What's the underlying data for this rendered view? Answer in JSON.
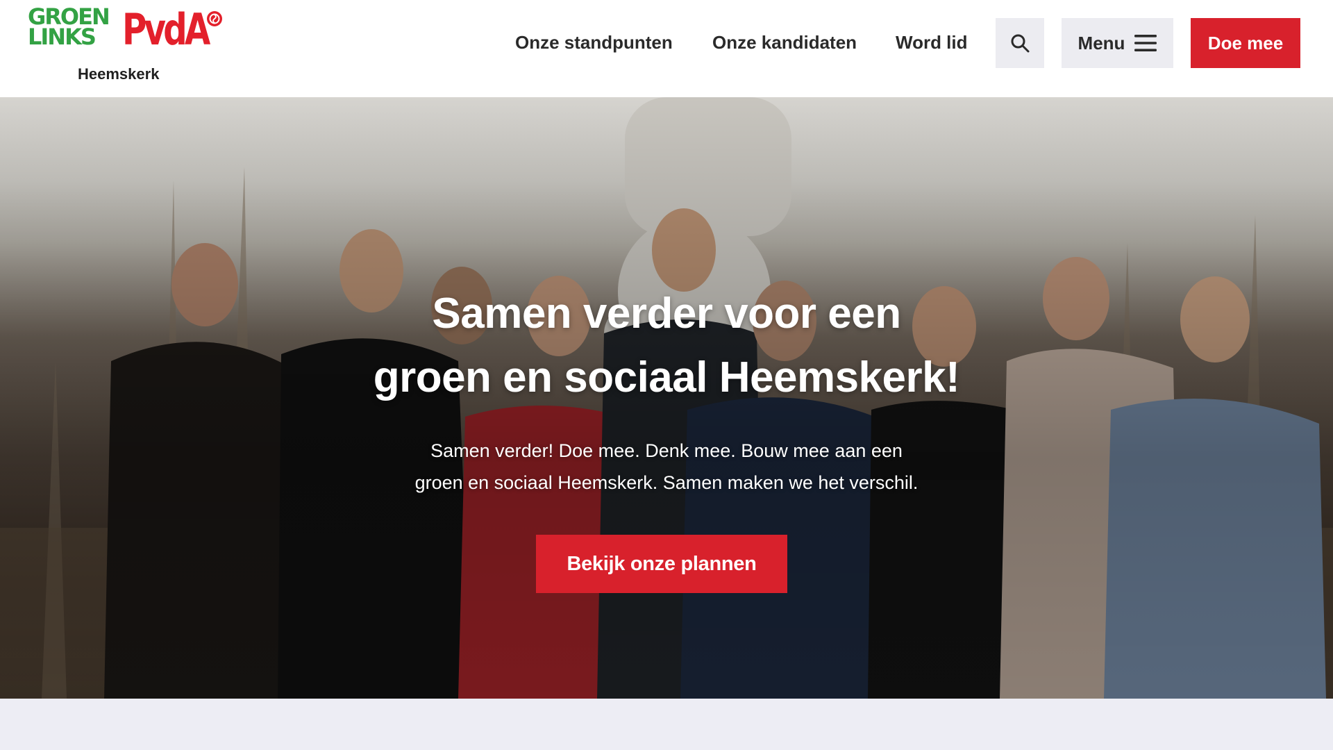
{
  "logo": {
    "line1": "GROEN",
    "line2": "LINKS",
    "brand": "PvdA",
    "location": "Heemskerk",
    "green": "#33a244",
    "red": "#e3202b",
    "rose_icon": "rose-icon"
  },
  "nav": {
    "items": [
      {
        "label": "Onze standpunten"
      },
      {
        "label": "Onze kandidaten"
      },
      {
        "label": "Word lid"
      }
    ],
    "search_icon": "search-icon",
    "menu_label": "Menu",
    "menu_icon": "hamburger-icon",
    "cta_label": "Doe mee"
  },
  "hero": {
    "title_line1": "Samen verder voor een",
    "title_line2": "groen en sociaal Heemskerk!",
    "subtitle_line1": "Samen verder! Doe mee. Denk mee. Bouw mee aan een",
    "subtitle_line2": "groen en sociaal Heemskerk. Samen maken we het verschil.",
    "button_label": "Bekijk onze plannen"
  },
  "colors": {
    "accent_red": "#d8212c",
    "nav_button_bg": "#ececf1",
    "text_dark": "#2a2a2a",
    "band_bg": "#ededf4"
  }
}
